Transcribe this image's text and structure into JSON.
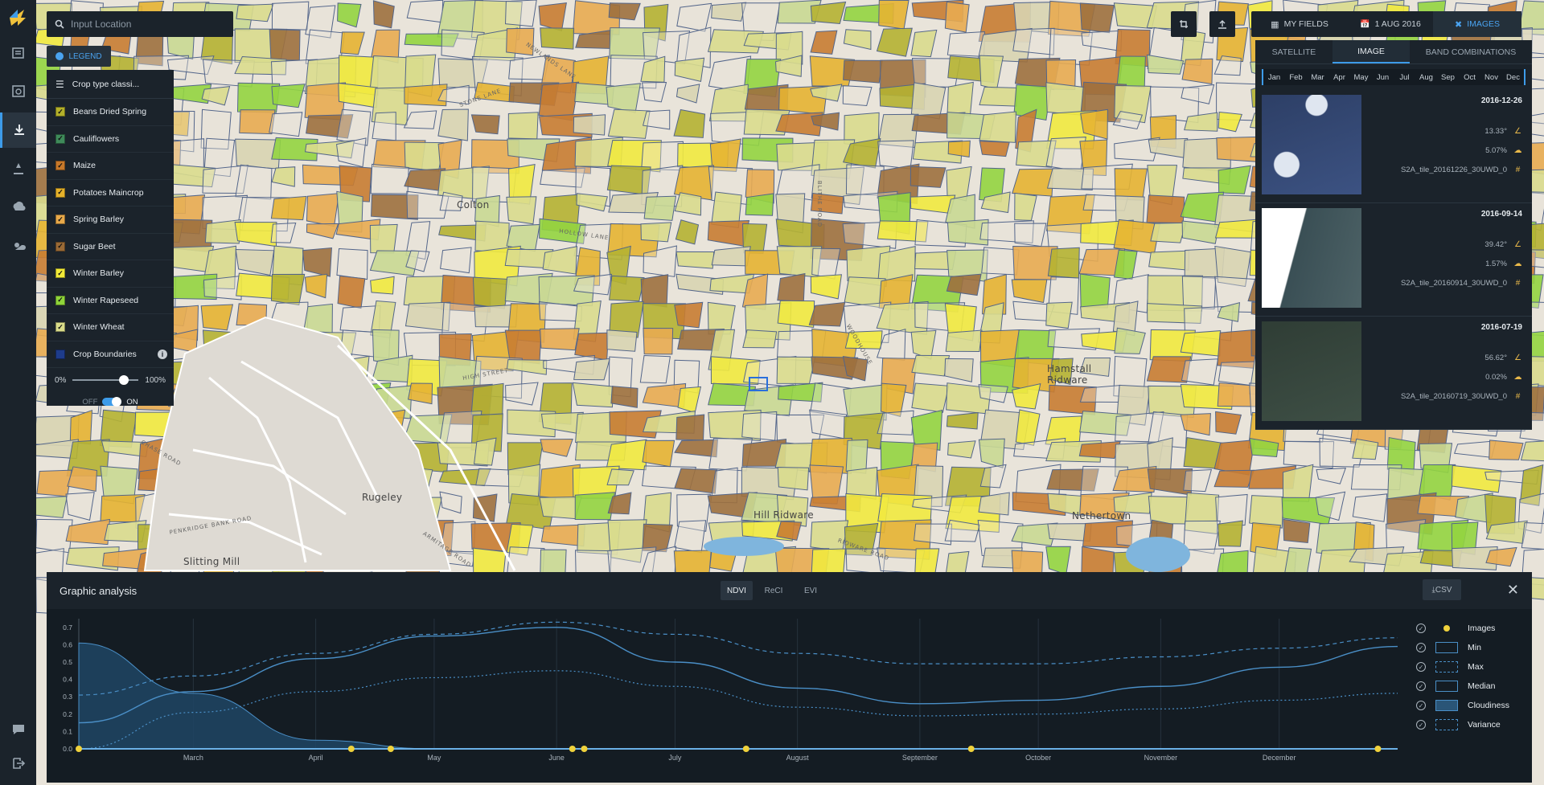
{
  "search": {
    "placeholder": "Input Location"
  },
  "legend": {
    "tab_label": "LEGEND",
    "layer_title": "Crop type classi...",
    "items": [
      {
        "label": "Beans Dried Spring",
        "color": "#b3b02a"
      },
      {
        "label": "Cauliflowers",
        "color": "#3f8a5a"
      },
      {
        "label": "Maize",
        "color": "#c7782a"
      },
      {
        "label": "Potatoes Maincrop",
        "color": "#e5b12a"
      },
      {
        "label": "Spring Barley",
        "color": "#e8a94a"
      },
      {
        "label": "Sugar Beet",
        "color": "#9a6a36"
      },
      {
        "label": "Winter Barley",
        "color": "#f2ea38"
      },
      {
        "label": "Winter Rapeseed",
        "color": "#8fd43a"
      },
      {
        "label": "Winter Wheat",
        "color": "#d9dc8a"
      }
    ],
    "boundaries_label": "Crop Boundaries",
    "boundaries_color": "#1e3c8c",
    "opacity_min": "0%",
    "opacity_max": "100%",
    "opacity_value": 0.78,
    "toggle_off": "OFF",
    "toggle_on": "ON"
  },
  "toolbar": {
    "my_fields": "MY FIELDS",
    "date": "1 AUG 2016",
    "images": "IMAGES"
  },
  "imagery": {
    "tabs": [
      "SATELLITE",
      "IMAGE",
      "BAND COMBINATIONS"
    ],
    "active_tab": "IMAGE",
    "months": [
      "Jan",
      "Feb",
      "Mar",
      "Apr",
      "May",
      "Jun",
      "Jul",
      "Aug",
      "Sep",
      "Oct",
      "Nov",
      "Dec"
    ],
    "images": [
      {
        "date": "2016-12-26",
        "angle": "13.33°",
        "cloud": "5.07%",
        "tile": "S2A_tile_20161226_30UWD_0"
      },
      {
        "date": "2016-09-14",
        "angle": "39.42°",
        "cloud": "1.57%",
        "tile": "S2A_tile_20160914_30UWD_0"
      },
      {
        "date": "2016-07-19",
        "angle": "56.62°",
        "cloud": "0.02%",
        "tile": "S2A_tile_20160719_30UWD_0"
      }
    ]
  },
  "map": {
    "places": [
      "Colton",
      "Rugeley",
      "Hill Ridware",
      "Hamstall Ridware",
      "Nethertown",
      "Slitting Mill"
    ],
    "roads": [
      "NEWLANDS LANE",
      "BLITHE ROAD",
      "HOLLOW LANE",
      "STONE LANE",
      "HIGH STREET",
      "WOODHOUSE",
      "RIDWARE ROAD",
      "CHASE ROAD",
      "PENKRIDGE BANK ROAD",
      "ARMITAGE ROAD"
    ]
  },
  "analysis": {
    "title": "Graphic analysis",
    "indices": [
      "NDVI",
      "ReCI",
      "EVI"
    ],
    "active_index": "NDVI",
    "csv_label": "⤓CSV",
    "close": "✕",
    "legend": [
      "Images",
      "Min",
      "Max",
      "Median",
      "Cloudiness",
      "Variance"
    ]
  },
  "chart_data": {
    "type": "line",
    "title": "",
    "ylim": [
      0,
      0.75
    ],
    "yticks": [
      "0.0",
      "0.1",
      "0.2",
      "0.3",
      "0.4",
      "0.5",
      "0.6",
      "0.7"
    ],
    "xticks": [
      "March",
      "April",
      "May",
      "June",
      "July",
      "August",
      "September",
      "October",
      "November",
      "December"
    ],
    "x": [
      "2016-02-01",
      "2016-03-01",
      "2016-04-01",
      "2016-05-01",
      "2016-06-01",
      "2016-07-01",
      "2016-08-01",
      "2016-09-01",
      "2016-10-01",
      "2016-11-01",
      "2016-12-01",
      "2016-12-31"
    ],
    "series": [
      {
        "name": "Max",
        "values": [
          0.31,
          0.42,
          0.55,
          0.66,
          0.73,
          0.66,
          0.55,
          0.49,
          0.49,
          0.53,
          0.58,
          0.64
        ]
      },
      {
        "name": "Median",
        "values": [
          0.15,
          0.33,
          0.52,
          0.65,
          0.7,
          0.5,
          0.35,
          0.26,
          0.28,
          0.36,
          0.47,
          0.59
        ]
      },
      {
        "name": "Min",
        "values": [
          0.0,
          0.21,
          0.33,
          0.41,
          0.45,
          0.36,
          0.24,
          0.19,
          0.2,
          0.23,
          0.28,
          0.32
        ]
      },
      {
        "name": "Cloudiness",
        "values": [
          0.61,
          0.32,
          0.05,
          0.0,
          0.0,
          0.0,
          0.0,
          0.0,
          0.0,
          0.0,
          0.0,
          0.0
        ]
      }
    ],
    "image_dates": [
      "2016-02-01",
      "2016-04-10",
      "2016-04-20",
      "2016-06-05",
      "2016-06-08",
      "2016-07-19",
      "2016-09-14",
      "2016-12-26"
    ],
    "legend_position": "right"
  }
}
